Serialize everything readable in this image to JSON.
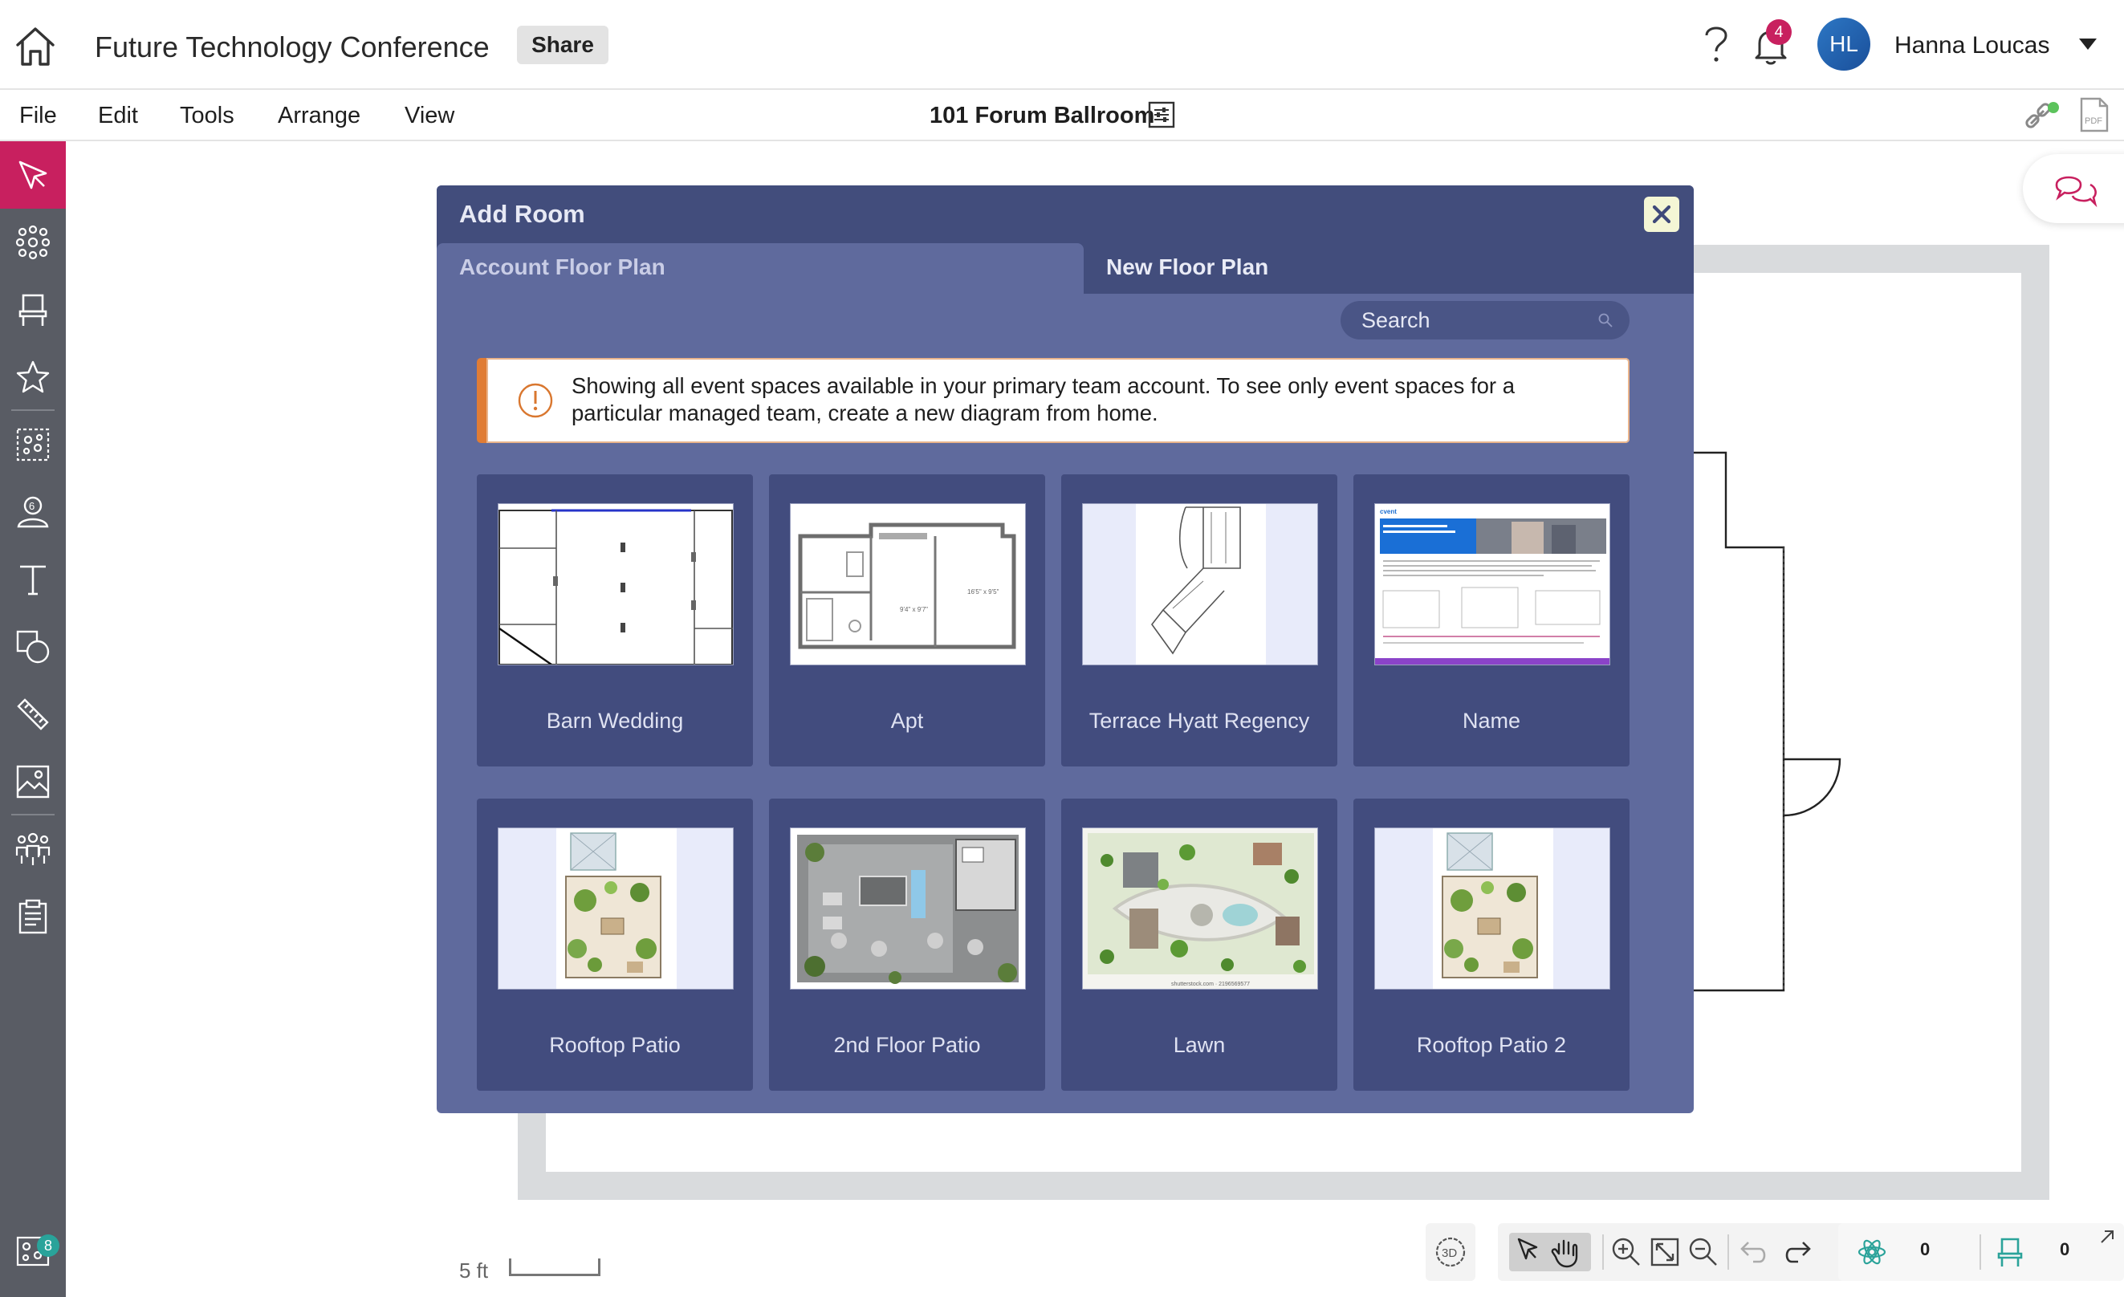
{
  "header": {
    "doc_title": "Future Technology Conference",
    "share_label": "Share",
    "notification_count": "4",
    "avatar_initials": "HL",
    "user_name": "Hanna Loucas"
  },
  "menubar": {
    "items": [
      "File",
      "Edit",
      "Tools",
      "Arrange",
      "View"
    ],
    "room_name": "101 Forum Ballroom"
  },
  "toolbar": {
    "tools": [
      "select",
      "items",
      "chairs",
      "favorites",
      "group",
      "attendees",
      "text",
      "shapes",
      "measure",
      "image",
      "people",
      "checklist",
      "objects"
    ],
    "objects_badge": "8"
  },
  "canvas": {
    "scale_label": "5 ft",
    "object_count": "0",
    "chair_count": "0"
  },
  "modal": {
    "title": "Add Room",
    "tabs": [
      "Account Floor Plan",
      "New Floor Plan"
    ],
    "active_tab": "Account Floor Plan",
    "search_placeholder": "Search",
    "notice": "Showing all event spaces available in your primary team account. To see only event spaces for a particular managed team, create a new diagram from home.",
    "rooms": [
      {
        "name": "Barn Wedding"
      },
      {
        "name": "Apt"
      },
      {
        "name": "Terrace Hyatt Regency"
      },
      {
        "name": "Name"
      },
      {
        "name": "Rooftop Patio"
      },
      {
        "name": "2nd Floor Patio"
      },
      {
        "name": "Lawn"
      },
      {
        "name": "Rooftop Patio 2"
      }
    ]
  },
  "colors": {
    "accent": "#c8205f",
    "toolbar_bg": "#595c64",
    "modal_bg": "#5f6a9d",
    "modal_header": "#424d7c",
    "card_bg": "#424c7e",
    "notice_border": "#e07c35",
    "badge_teal": "#29a39a"
  }
}
